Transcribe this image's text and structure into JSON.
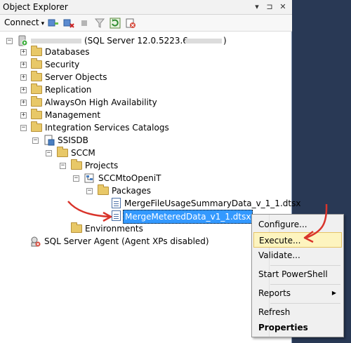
{
  "window": {
    "title": "Object Explorer",
    "pin_glyph": "▾",
    "autohide_glyph": "⊐",
    "close_glyph": "✕"
  },
  "toolbar": {
    "connect_label": "Connect",
    "connect_caret": "▾"
  },
  "tree": {
    "collapse_glyph": "−",
    "expand_glyph": "+",
    "server": {
      "name_obscured": true,
      "suffix": "(SQL Server 12.0.5223.6 -"
    },
    "top_nodes": [
      "Databases",
      "Security",
      "Server Objects",
      "Replication",
      "AlwaysOn High Availability",
      "Management",
      "Integration Services Catalogs"
    ],
    "ssisdb": "SSISDB",
    "sccm": "SCCM",
    "projects": "Projects",
    "project_name": "SCCMtoOpeniT",
    "packages": "Packages",
    "package_1": "MergeFileUsageSummaryData_v_1_1.dtsx",
    "package_2": "MergeMeteredData_v1_1.dtsx",
    "environments": "Environments",
    "agent": "SQL Server Agent (Agent XPs disabled)"
  },
  "context_menu": {
    "configure": "Configure...",
    "execute": "Execute...",
    "validate": "Validate...",
    "start_powershell": "Start PowerShell",
    "reports": "Reports",
    "reports_arrow": "▶",
    "refresh": "Refresh",
    "properties": "Properties"
  },
  "colors": {
    "highlight": "#fdf4bf",
    "selection": "#3399ff",
    "annotation_arrow": "#d9342b",
    "side_panel": "#293955"
  }
}
